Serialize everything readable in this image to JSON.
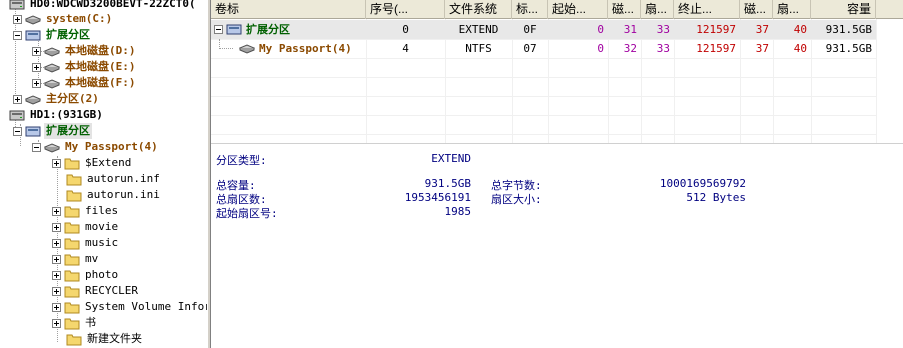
{
  "tree": {
    "items": [
      {
        "label": "HD0:WDCWD3200BEVT-22ZCT0(",
        "style": "black"
      },
      {
        "label": "system(C:)",
        "style": "brown"
      },
      {
        "label": "扩展分区",
        "style": "green"
      },
      {
        "label": "本地磁盘(D:)",
        "style": "brown"
      },
      {
        "label": "本地磁盘(E:)",
        "style": "brown"
      },
      {
        "label": "本地磁盘(F:)",
        "style": "brown"
      },
      {
        "label": "主分区(2)",
        "style": "brown"
      },
      {
        "label": "HD1:(931GB)",
        "style": "black"
      },
      {
        "label": "扩展分区",
        "style": "green"
      },
      {
        "label": "My Passport(4)",
        "style": "brown"
      },
      {
        "label": "$Extend",
        "style": "black"
      },
      {
        "label": "autorun.inf",
        "style": "black"
      },
      {
        "label": "autorun.ini",
        "style": "black"
      },
      {
        "label": "files",
        "style": "black"
      },
      {
        "label": "movie",
        "style": "black"
      },
      {
        "label": "music",
        "style": "black"
      },
      {
        "label": "mv",
        "style": "black"
      },
      {
        "label": "photo",
        "style": "black"
      },
      {
        "label": "RECYCLER",
        "style": "black"
      },
      {
        "label": "System Volume Inform",
        "style": "black"
      },
      {
        "label": "书",
        "style": "black"
      },
      {
        "label": "新建文件夹",
        "style": "black"
      }
    ]
  },
  "table": {
    "columns": [
      "卷标",
      "序号(...",
      "文件系统",
      "标...",
      "起始...",
      "磁...",
      "扇...",
      "终止...",
      "磁...",
      "扇...",
      "容量"
    ],
    "rows": [
      {
        "label": "扩展分区",
        "seq": "0",
        "fs": "EXTEND",
        "flag": "0F",
        "start": "0",
        "c1": "31",
        "s1": "33",
        "end": "121597",
        "c2": "37",
        "s2": "40",
        "cap": "931.5GB"
      },
      {
        "label": "My Passport(4)",
        "seq": "4",
        "fs": "NTFS",
        "flag": "07",
        "start": "0",
        "c1": "32",
        "s1": "33",
        "end": "121597",
        "c2": "37",
        "s2": "40",
        "cap": "931.5GB"
      }
    ]
  },
  "info": {
    "type_label": "分区类型:",
    "type_value": "EXTEND",
    "total_cap_label": "总容量:",
    "total_cap_value": "931.5GB",
    "total_bytes_label": "总字节数:",
    "total_bytes_value": "1000169569792",
    "total_sectors_label": "总扇区数:",
    "total_sectors_value": "1953456191",
    "sector_size_label": "扇区大小:",
    "sector_size_value": "512 Bytes",
    "start_sector_label": "起始扇区号:",
    "start_sector_value": "1985"
  },
  "colors": {
    "green": "#006000",
    "brown": "#8b4a00",
    "info": "#000080",
    "purple": "#a000a0",
    "red": "#c00000"
  }
}
